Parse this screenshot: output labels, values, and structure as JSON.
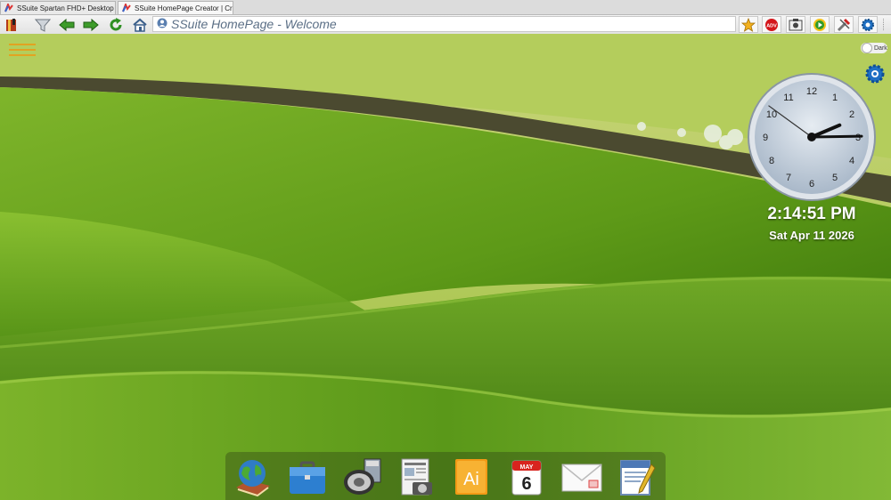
{
  "tabs": [
    {
      "label": "SSuite Spartan FHD+ Desktop |",
      "active": false
    },
    {
      "label": "SSuite HomePage Creator | Cr",
      "active": true
    }
  ],
  "toolbar": {
    "page_title": "SSuite HomePage - Welcome",
    "left_icons": [
      "bookmark-book-icon",
      "filter-icon",
      "back-arrow-icon",
      "forward-arrow-icon",
      "refresh-icon",
      "home-icon"
    ],
    "right_icons": [
      "favorite-star-icon",
      "adv-blocker-icon",
      "screenshot-icon",
      "play-icon",
      "tools-icon",
      "settings-gear-icon"
    ],
    "adv_label": "ADV"
  },
  "desktop": {
    "dark_mode_label": "Dark",
    "clock": {
      "numerals": [
        "12",
        "1",
        "2",
        "3",
        "4",
        "5",
        "6",
        "7",
        "8",
        "9",
        "10",
        "11"
      ],
      "time": "2:14:51 PM",
      "date": "Sat Apr 11 2026",
      "hours": 2,
      "minutes": 14,
      "seconds": 51
    },
    "dock": {
      "icons": [
        "globe-book-icon",
        "briefcase-icon",
        "speaker-icon",
        "news-camera-icon",
        "illustrator-icon",
        "calendar-icon",
        "mail-icon",
        "notepad-icon"
      ],
      "illustrator_text": "Ai",
      "calendar_month": "MAY",
      "calendar_day": "6"
    }
  },
  "colors": {
    "sky_green": "#a9c84a",
    "field_green": "#5f9d16",
    "dark_stripe": "#4a4a2a",
    "address_text": "#5b6f86"
  }
}
